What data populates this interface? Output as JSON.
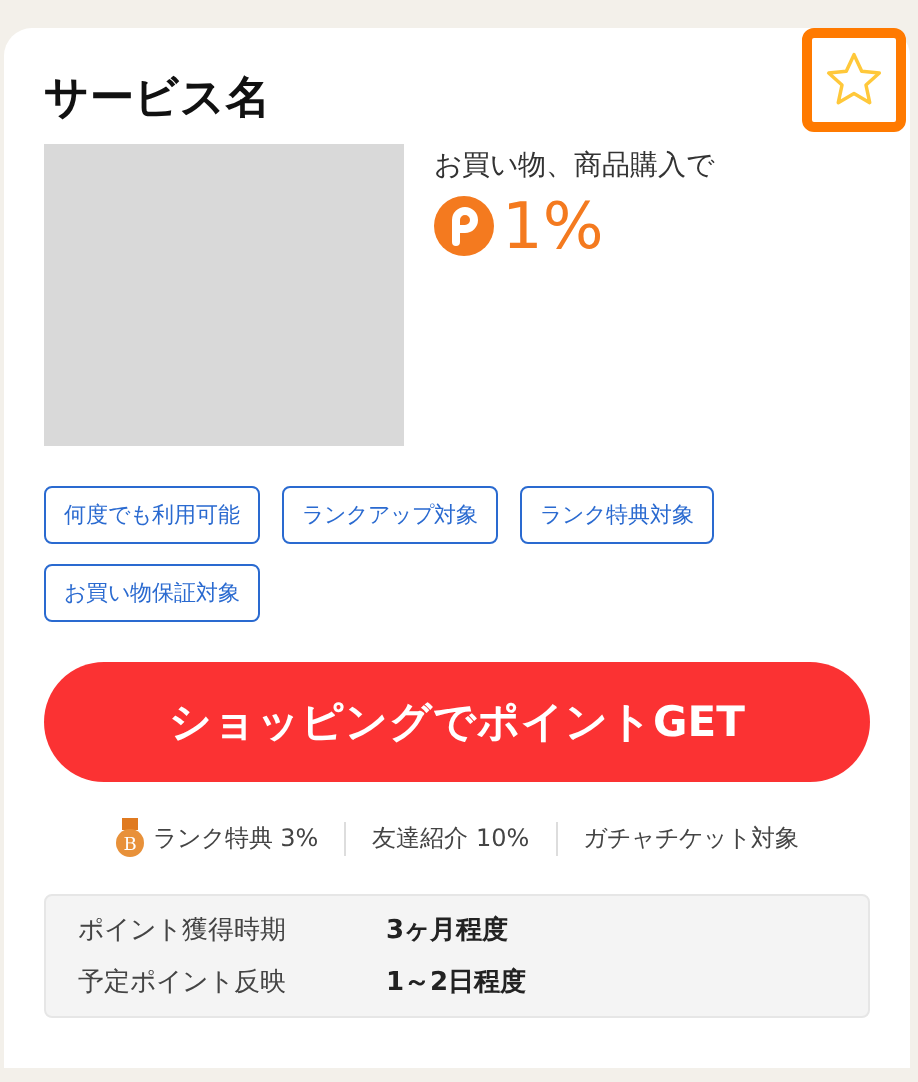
{
  "service": {
    "title": "サービス名",
    "favorite": {
      "selected": false,
      "highlighted": true
    }
  },
  "reward": {
    "caption": "お買い物、商品購入で",
    "rate": "1%"
  },
  "tags": [
    "何度でも利用可能",
    "ランクアップ対象",
    "ランク特典対象",
    "お買い物保証対象"
  ],
  "action": {
    "label": "ショッピングでポイントGET"
  },
  "perks": [
    {
      "kind": "medal",
      "label": "ランク特典",
      "value": "3%"
    },
    {
      "kind": "plain",
      "label": "友達紹介",
      "value": "10%"
    },
    {
      "kind": "plain",
      "label": "ガチャチケット対象"
    }
  ],
  "medal_letter": "B",
  "info": [
    {
      "label": "ポイント獲得時期",
      "value": "3ヶ月程度"
    },
    {
      "label": "予定ポイント反映",
      "value": "1～2日程度"
    }
  ]
}
